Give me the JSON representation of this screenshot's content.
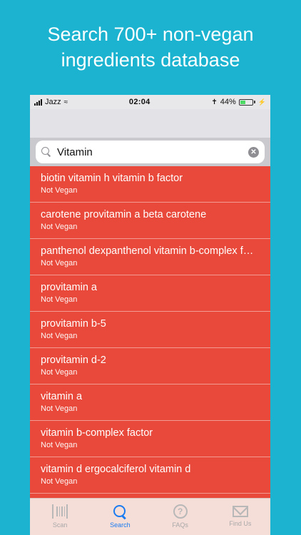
{
  "headline": {
    "line1": "Search 700+ non-vegan",
    "line2": "ingredients database"
  },
  "status_bar": {
    "carrier": "Jazz",
    "time": "02:04",
    "battery_percent": "44%",
    "battery_level": 0.44
  },
  "search": {
    "value": "Vitamin",
    "placeholder": "Search"
  },
  "results": [
    {
      "name": "biotin vitamin h vitamin b factor",
      "status": "Not Vegan"
    },
    {
      "name": "carotene provitamin a beta carotene",
      "status": "Not Vegan"
    },
    {
      "name": "panthenol dexpanthenol vitamin b-complex factor",
      "status": "Not Vegan"
    },
    {
      "name": "provitamin a",
      "status": "Not Vegan"
    },
    {
      "name": "provitamin b-5",
      "status": "Not Vegan"
    },
    {
      "name": "provitamin d-2",
      "status": "Not Vegan"
    },
    {
      "name": "vitamin a",
      "status": "Not Vegan"
    },
    {
      "name": "vitamin b-complex factor",
      "status": "Not Vegan"
    },
    {
      "name": "vitamin d ergocalciferol vitamin d",
      "status": "Not Vegan"
    }
  ],
  "tabs": [
    {
      "label": "Scan",
      "icon": "barcode-icon"
    },
    {
      "label": "Search",
      "icon": "search-icon"
    },
    {
      "label": "FAQs",
      "icon": "question-icon"
    },
    {
      "label": "Find Us",
      "icon": "mail-icon"
    }
  ],
  "colors": {
    "background": "#1bb3cf",
    "result_row": "#e8493a",
    "active_tab": "#1a7cf0"
  }
}
